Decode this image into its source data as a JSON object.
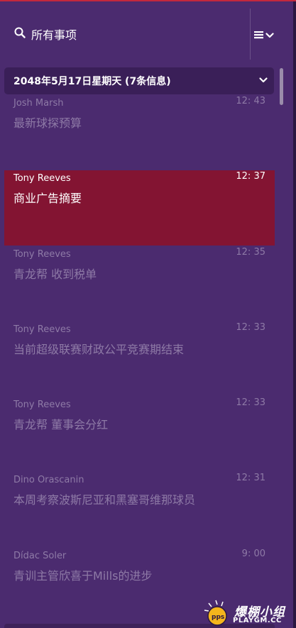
{
  "header": {
    "search_label": "所有事项"
  },
  "date_group": {
    "label": "2048年5月17日星期天 (7条信息)"
  },
  "messages": [
    {
      "sender": "Josh Marsh",
      "time": "12: 43",
      "subject": "最新球探预算",
      "selected": false
    },
    {
      "sender": "Tony Reeves",
      "time": "12: 37",
      "subject": "商业广告摘要",
      "selected": true
    },
    {
      "sender": "Tony Reeves",
      "time": "12: 35",
      "subject": "青龙帮 收到税单",
      "selected": false
    },
    {
      "sender": "Tony Reeves",
      "time": "12: 33",
      "subject": "当前超级联赛财政公平竞赛期结束",
      "selected": false
    },
    {
      "sender": "Tony Reeves",
      "time": "12: 33",
      "subject": "青龙帮 董事会分红",
      "selected": false
    },
    {
      "sender": "Dino Orascanin",
      "time": "12: 31",
      "subject": "本周考察波斯尼亚和黑塞哥维那球员",
      "selected": false
    },
    {
      "sender": "Dídac Soler",
      "time": "9: 00",
      "subject": "青训主管欣喜于Mills的进步",
      "selected": false
    }
  ],
  "watermark": {
    "brand_cn": "爆棚小组",
    "brand_en": "PLAYGM.CC",
    "badge": "pps"
  },
  "colors": {
    "background": "#4b2b6f",
    "selected_row": "#831432",
    "accent_top": "#c4283d",
    "muted_text": "#8e7aa6"
  },
  "icons": {
    "search": "search-icon",
    "menu": "list-menu-icon",
    "dropdown": "chevron-down-icon"
  }
}
